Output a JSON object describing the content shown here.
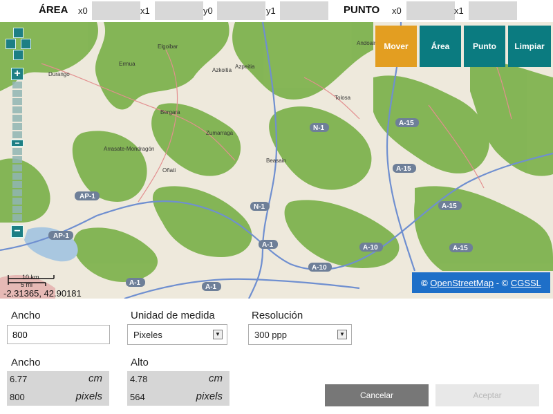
{
  "top_bar": {
    "area_label": "ÁREA",
    "area_fields": [
      {
        "label": "x0",
        "value": ""
      },
      {
        "label": "x1",
        "value": ""
      },
      {
        "label": "y0",
        "value": ""
      },
      {
        "label": "y1",
        "value": ""
      }
    ],
    "punto_label": "PUNTO",
    "punto_fields": [
      {
        "label": "x0",
        "value": ""
      },
      {
        "label": "x1",
        "value": ""
      }
    ]
  },
  "map": {
    "tools": [
      "Mover",
      "Área",
      "Punto",
      "Limpiar"
    ],
    "active_tool": "Mover",
    "attribution_prefix": "©",
    "attribution_osm": "OpenStreetMap",
    "attribution_sep": " - © ",
    "attribution_cgssl": "CGSSL",
    "cursor_coords": "-2.31365, 42.90181",
    "scale": {
      "km": "10 km",
      "mi": "5 mi"
    },
    "zoom_in": "+",
    "zoom_out": "−",
    "places": [
      "Elgoibar",
      "Ermua",
      "Durango",
      "Azkoitia",
      "Azpeitia",
      "Andoain",
      "Tolosa",
      "Bergara",
      "Zumarraga",
      "Arrasate-Mondragón",
      "Oñati",
      "Beasain"
    ],
    "roads": [
      "AP-1",
      "AP-1",
      "N-1",
      "N-1",
      "A-1",
      "A-1",
      "A-1",
      "A-10",
      "A-10",
      "A-15",
      "A-15",
      "A-15",
      "A-15"
    ],
    "colors": {
      "tool_active": "#e39e21",
      "tool": "#0b7b80",
      "attribution": "#1e6fc8",
      "forest": "#7fb34f",
      "land": "#eee9dc"
    }
  },
  "form": {
    "width_label": "Ancho",
    "width_value": "800",
    "unit_label": "Unidad de medida",
    "unit_value": "Pixeles",
    "resolution_label": "Resolución",
    "resolution_value": "300 ppp",
    "ancho_label": "Ancho",
    "ancho_cm": "6.77",
    "ancho_px": "800",
    "alto_label": "Alto",
    "alto_cm": "4.78",
    "alto_px": "564",
    "cm_unit": "cm",
    "px_unit": "pixels",
    "cancel_label": "Cancelar",
    "accept_label": "Aceptar"
  }
}
